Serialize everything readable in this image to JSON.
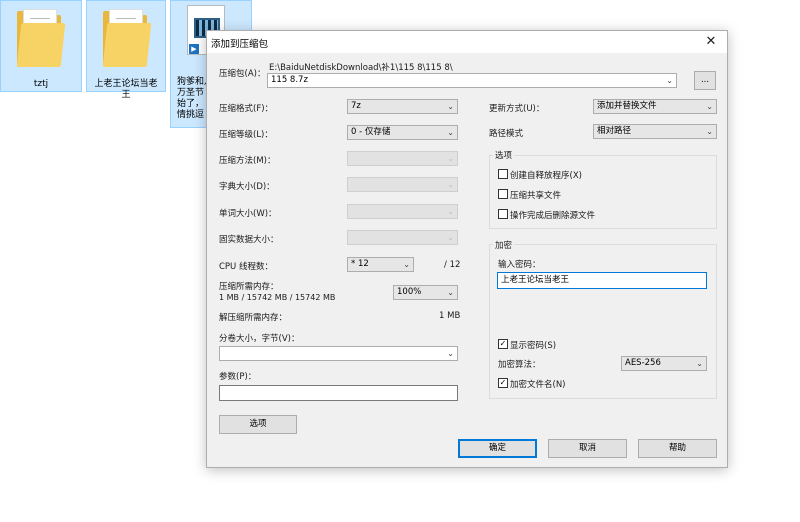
{
  "desktop": {
    "items": [
      {
        "label": "tztj"
      },
      {
        "label": "上老王论坛当老王"
      },
      {
        "label_lines": [
          "狗爹和儿",
          "万圣节",
          "始了，",
          "情挑逗"
        ]
      }
    ]
  },
  "dialog": {
    "title": "添加到压缩包",
    "archive": {
      "label": "压缩包(A)：",
      "path": "E:\\BaiduNetdiskDownload\\补1\\115 8\\115 8\\",
      "value": "115 8.7z",
      "browse_label": "..."
    },
    "left": {
      "format": {
        "label": "压缩格式(F)：",
        "value": "7z"
      },
      "level": {
        "label": "压缩等级(L)：",
        "value": "0 - 仅存储"
      },
      "method": {
        "label": "压缩方法(M)："
      },
      "dict": {
        "label": "字典大小(D)："
      },
      "word": {
        "label": "单词大小(W)："
      },
      "solid": {
        "label": "固实数据大小："
      },
      "threads": {
        "label": "CPU 线程数：",
        "value": "* 12",
        "max": "/ 12"
      },
      "mem_compress": {
        "label": "压缩所需内存：",
        "detail": "1 MB / 15742 MB / 15742 MB",
        "value": "100%"
      },
      "mem_decompress": {
        "label": "解压缩所需内存：",
        "value": "1 MB"
      },
      "volume": {
        "label": "分卷大小，字节(V)："
      },
      "params": {
        "label": "参数(P)："
      },
      "options_button": "选项"
    },
    "right": {
      "update": {
        "label": "更新方式(U)：",
        "value": "添加并替换文件"
      },
      "path_mode": {
        "label": "路径模式",
        "value": "相对路径"
      },
      "options_group": {
        "title": "选项",
        "sfx": "创建自释放程序(X)",
        "shared": "压缩共享文件",
        "delete": "操作完成后删除源文件"
      },
      "encrypt_group": {
        "title": "加密",
        "password_label": "输入密码：",
        "password_value": "上老王论坛当老王",
        "show_password": "显示密码(S)",
        "method_label": "加密算法：",
        "method_value": "AES-256",
        "encrypt_names": "加密文件名(N)"
      }
    },
    "buttons": {
      "ok": "确定",
      "cancel": "取消",
      "help": "帮助"
    }
  },
  "colors": {
    "accent": "#0078d7",
    "folder": "#f7d264",
    "selection": "#cce8ff"
  }
}
